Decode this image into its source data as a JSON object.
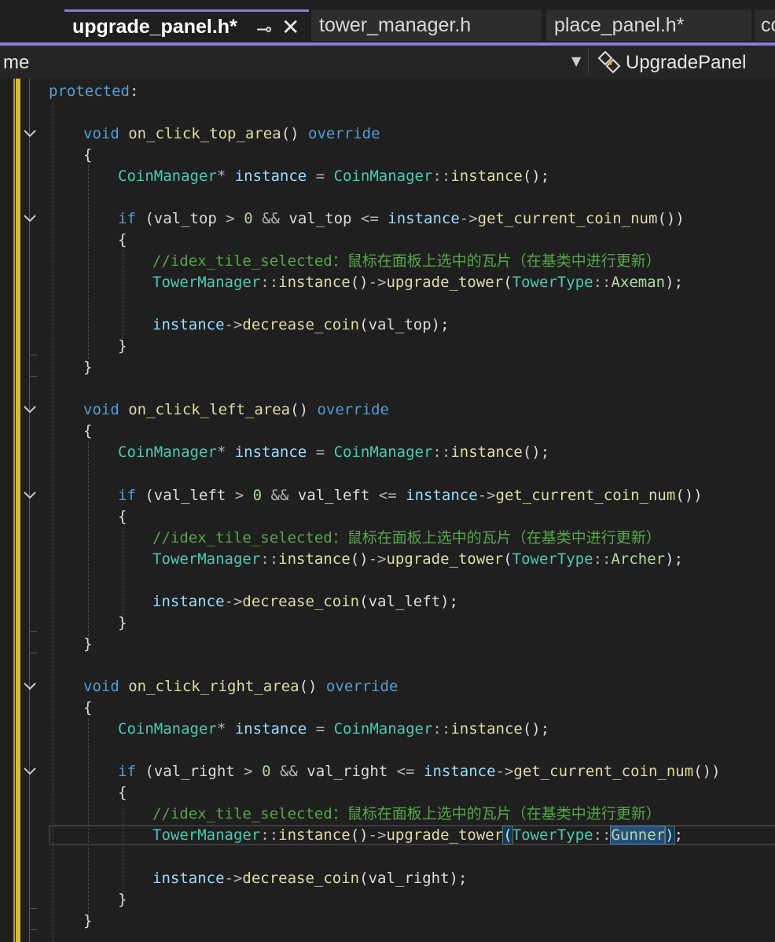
{
  "tabs": [
    {
      "label": "upgrade_panel.h*",
      "active": true
    },
    {
      "label": "tower_manager.h",
      "active": false
    },
    {
      "label": "place_panel.h*",
      "active": false
    },
    {
      "label": "co",
      "active": false
    }
  ],
  "nav": {
    "scope": "me",
    "class_name": "UpgradePanel"
  },
  "code": {
    "protected": "protected",
    "top": {
      "signature": "on_click_top_area",
      "cond_var": "val_top",
      "comment": "//idex_tile_selected：鼠标在面板上选中的瓦片（在基类中进行更新）",
      "tower_type": "Axeman",
      "dec_arg": "val_top"
    },
    "left": {
      "signature": "on_click_left_area",
      "cond_var": "val_left",
      "comment": "//idex_tile_selected：鼠标在面板上选中的瓦片（在基类中进行更新）",
      "tower_type": "Archer",
      "dec_arg": "val_left"
    },
    "right": {
      "signature": "on_click_right_area",
      "cond_var": "val_right",
      "comment": "//idex_tile_selected：鼠标在面板上选中的瓦片（在基类中进行更新）",
      "tower_type": "Gunner",
      "dec_arg": "val_right"
    },
    "tokens": {
      "void": "void",
      "override": "override",
      "coin_manager": "CoinManager",
      "instance": "instance",
      "instance_fn": "instance",
      "if": "if",
      "get_coin": "get_current_coin_num",
      "tower_manager": "TowerManager",
      "upgrade_tower": "upgrade_tower",
      "tower_type_enum": "TowerType",
      "decrease_coin": "decrease_coin",
      "zero": "0"
    }
  },
  "colors": {
    "accent": "#8b7ad9",
    "keyword": "#569cd6",
    "type": "#4ec9b0",
    "function": "#dcdcaa",
    "variable": "#9cdcfe",
    "comment": "#57a64a",
    "change_bar": "#d7ba3c"
  }
}
